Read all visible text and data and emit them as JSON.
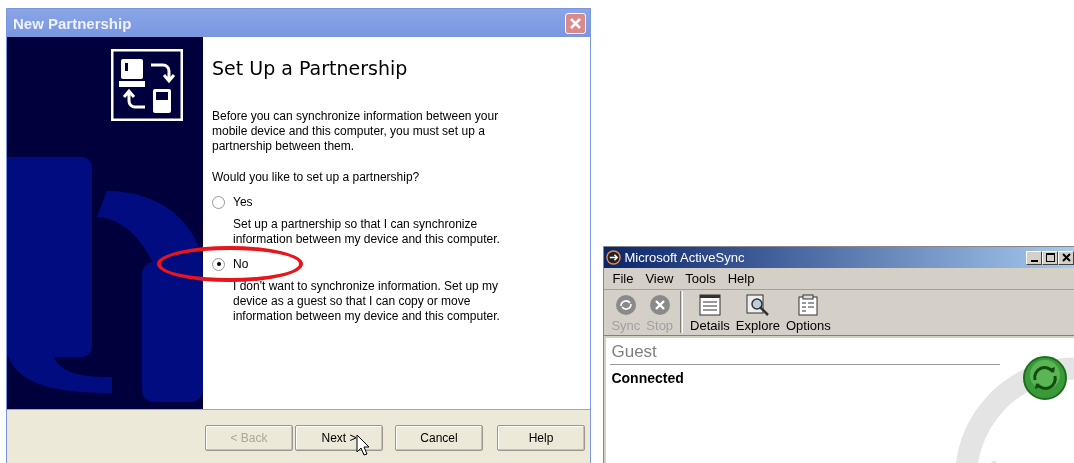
{
  "wizard": {
    "title": "New Partnership",
    "heading": "Set Up a Partnership",
    "intro": "Before you can synchronize information between your mobile device and this computer, you must set up a partnership between them.",
    "question": "Would you like to set up a partnership?",
    "options": [
      {
        "label": "Yes",
        "selected": false,
        "highlighted": false,
        "description": "Set up a partnership so that I can synchronize information between my device and this computer."
      },
      {
        "label": "No",
        "selected": true,
        "highlighted": true,
        "description": "I don't want to synchronize information. Set up my device as a guest so that I can copy or move information between my device and this computer."
      }
    ],
    "buttons": [
      {
        "label": "< Back",
        "disabled": true,
        "hovered": false
      },
      {
        "label": "Next >",
        "disabled": false,
        "hovered": true
      },
      {
        "label": "Cancel",
        "disabled": false,
        "hovered": false
      },
      {
        "label": "Help",
        "disabled": false,
        "hovered": false
      }
    ]
  },
  "activesync": {
    "title": "Microsoft ActiveSync",
    "menu": [
      "File",
      "View",
      "Tools",
      "Help"
    ],
    "toolbar": [
      {
        "label": "Sync",
        "kind": "sync",
        "disabled": true
      },
      {
        "label": "Stop",
        "kind": "stop",
        "disabled": true
      },
      {
        "label": "Details",
        "kind": "details",
        "disabled": false
      },
      {
        "label": "Explore",
        "kind": "explore",
        "disabled": false
      },
      {
        "label": "Options",
        "kind": "options",
        "disabled": false
      }
    ],
    "device": "Guest",
    "status": "Connected"
  }
}
